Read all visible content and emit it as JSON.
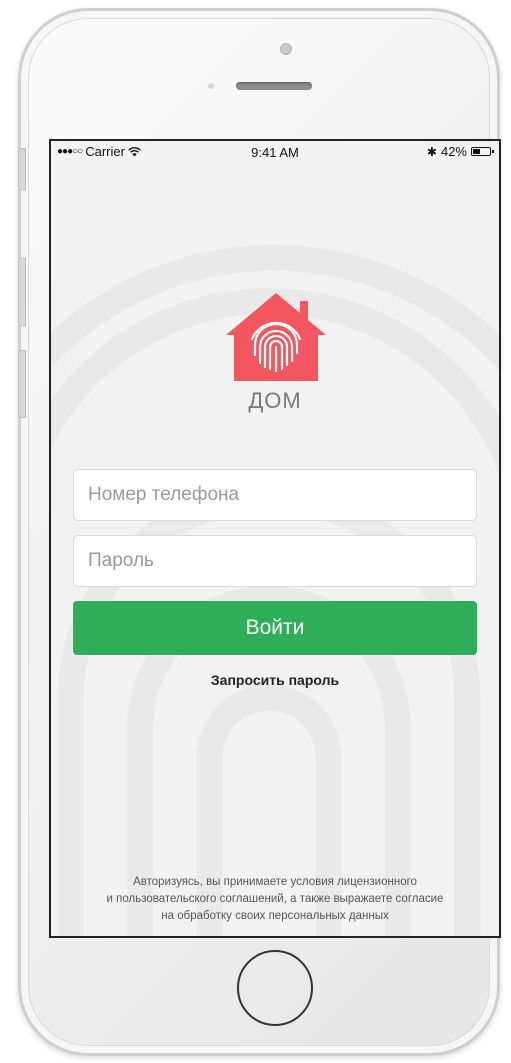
{
  "status_bar": {
    "signal": "●●●○○",
    "carrier": "Carrier",
    "time": "9:41 AM",
    "bluetooth": "✱",
    "battery_percent": "42%",
    "battery_level": 0.42
  },
  "logo": {
    "icon": "house-fingerprint-icon",
    "color": "#f2575f",
    "text": "ДОМ"
  },
  "form": {
    "phone_placeholder": "Номер телефона",
    "password_placeholder": "Пароль",
    "login_label": "Войти",
    "login_color": "#2fae5a",
    "request_password_label": "Запросить пароль"
  },
  "terms": {
    "line1": "Авторизуясь, вы принимаете условия лицензионного",
    "line2": "и пользовательского соглашений, а также выражаете согласие",
    "line3": "на обработку своих персональных данных"
  }
}
